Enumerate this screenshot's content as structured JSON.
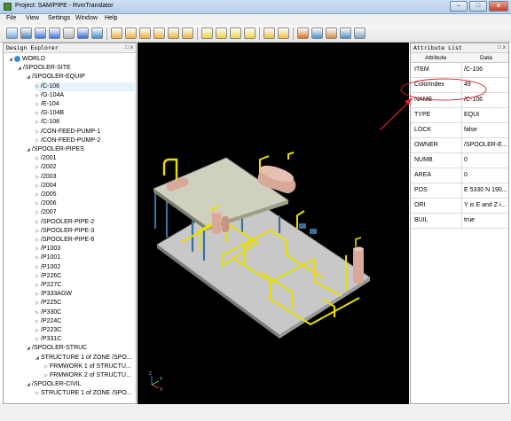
{
  "window": {
    "title": "Project: SAM/PIPE - RvmTranslator",
    "minimize": "–",
    "maximize": "□",
    "close": "x"
  },
  "menu": [
    "File",
    "View",
    "Settings",
    "Window",
    "Help"
  ],
  "explorer": {
    "title": "Design Explorer",
    "buttons": "□ x",
    "tree": [
      {
        "label": "WORLD",
        "depth": 0,
        "exp": "◢",
        "icon": "world"
      },
      {
        "label": "/SPOOLER-SITE",
        "depth": 1,
        "exp": "◢"
      },
      {
        "label": "/SPOOLER-EQUIP",
        "depth": 2,
        "exp": "◢"
      },
      {
        "label": "/C-106",
        "depth": 3,
        "exp": "▷",
        "selected": true
      },
      {
        "label": "/G-104A",
        "depth": 3,
        "exp": "▷"
      },
      {
        "label": "/E-104",
        "depth": 3,
        "exp": "▷"
      },
      {
        "label": "/G-104B",
        "depth": 3,
        "exp": "▷"
      },
      {
        "label": "/C-108",
        "depth": 3,
        "exp": "▷"
      },
      {
        "label": "/CON-FEED-PUMP-1",
        "depth": 3,
        "exp": "▷"
      },
      {
        "label": "/CON-FEED-PUMP-2",
        "depth": 3,
        "exp": "▷"
      },
      {
        "label": "/SPOOLER-PIPES",
        "depth": 2,
        "exp": "◢"
      },
      {
        "label": "/2001",
        "depth": 3,
        "exp": "▷"
      },
      {
        "label": "/2002",
        "depth": 3,
        "exp": "▷"
      },
      {
        "label": "/2003",
        "depth": 3,
        "exp": "▷"
      },
      {
        "label": "/2004",
        "depth": 3,
        "exp": "▷"
      },
      {
        "label": "/2005",
        "depth": 3,
        "exp": "▷"
      },
      {
        "label": "/2006",
        "depth": 3,
        "exp": "▷"
      },
      {
        "label": "/2007",
        "depth": 3,
        "exp": "▷"
      },
      {
        "label": "/SPOOLER-PIPE-2",
        "depth": 3,
        "exp": "▷"
      },
      {
        "label": "/SPOOLER-PIPE-3",
        "depth": 3,
        "exp": "▷"
      },
      {
        "label": "/SPOOLER-PIPE-6",
        "depth": 3,
        "exp": "▷"
      },
      {
        "label": "/P1003",
        "depth": 3,
        "exp": "▷"
      },
      {
        "label": "/P1001",
        "depth": 3,
        "exp": "▷"
      },
      {
        "label": "/P1002",
        "depth": 3,
        "exp": "▷"
      },
      {
        "label": "/P226C",
        "depth": 3,
        "exp": "▷"
      },
      {
        "label": "/P227C",
        "depth": 3,
        "exp": "▷"
      },
      {
        "label": "/P333AGW",
        "depth": 3,
        "exp": "▷"
      },
      {
        "label": "/P225C",
        "depth": 3,
        "exp": "▷"
      },
      {
        "label": "/P330C",
        "depth": 3,
        "exp": "▷"
      },
      {
        "label": "/P224C",
        "depth": 3,
        "exp": "▷"
      },
      {
        "label": "/P223C",
        "depth": 3,
        "exp": "▷"
      },
      {
        "label": "/P331C",
        "depth": 3,
        "exp": "▷"
      },
      {
        "label": "/SPOOLER-STRUC",
        "depth": 2,
        "exp": "◢"
      },
      {
        "label": "STRUCTURE 1 of ZONE /SPO...",
        "depth": 3,
        "exp": "◢"
      },
      {
        "label": "FRMWORK 1 of STRUCTU...",
        "depth": 4,
        "exp": "▷"
      },
      {
        "label": "FRMWORK 2 of STRUCTU...",
        "depth": 4,
        "exp": "▷"
      },
      {
        "label": "/SPOOLER-CIVIL",
        "depth": 2,
        "exp": "◢"
      },
      {
        "label": "STRUCTURE 1 of ZONE /SPO...",
        "depth": 3,
        "exp": "▷"
      }
    ]
  },
  "attributes": {
    "title": "Attribute List",
    "buttons": "□ x",
    "col_attribute": "Attribute",
    "col_data": "Data",
    "rows": [
      {
        "key": "ITEM",
        "value": "/C-106"
      },
      {
        "key": "ColorIndex",
        "value": "49"
      },
      {
        "key": "NAME",
        "value": "/C-106"
      },
      {
        "key": "TYPE",
        "value": "EQUI"
      },
      {
        "key": "LOCK",
        "value": "false"
      },
      {
        "key": "OWNER",
        "value": "/SPOOLER-E..."
      },
      {
        "key": "NUMB",
        "value": "0"
      },
      {
        "key": "AREA",
        "value": "0"
      },
      {
        "key": "POS",
        "value": "E 5330 N 190..."
      },
      {
        "key": "ORI",
        "value": "Y is E and Z i..."
      },
      {
        "key": "BUIL",
        "value": "true"
      }
    ]
  },
  "viewport": {
    "axis_z": "Z",
    "axis_y": "Y",
    "axis_x": "X",
    "annotation_color": "#e02020",
    "pipe_color": "#e8e000",
    "vessel_color": "#d8a898",
    "deck_color": "#cfd0bf",
    "column_color": "#3a6f96"
  },
  "toolbar_icons": [
    "open-icon",
    "save-icon",
    "add-icon",
    "minus-icon",
    "settings-icon",
    "move-icon",
    "refresh-icon",
    "cube-front-icon",
    "cube-back-icon",
    "cube-left-icon",
    "cube-right-icon",
    "cube-top-icon",
    "cube-bottom-icon",
    "iso-1-icon",
    "iso-2-icon",
    "iso-3-icon",
    "iso-4-icon",
    "search-icon",
    "pick-icon",
    "sphere-icon",
    "plugin-icon",
    "measure-icon",
    "color-icon",
    "panel-icon"
  ]
}
